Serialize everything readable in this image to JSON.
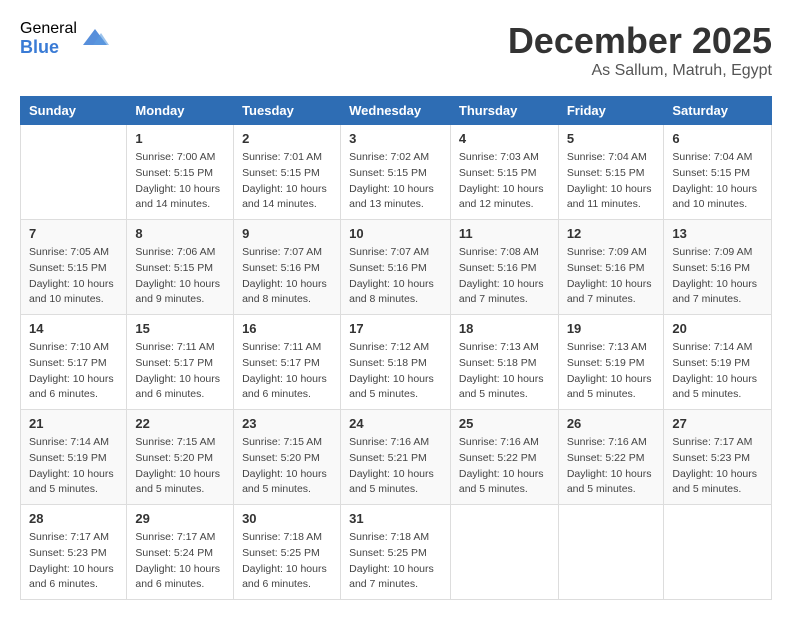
{
  "logo": {
    "general": "General",
    "blue": "Blue"
  },
  "title": {
    "month": "December 2025",
    "location": "As Sallum, Matruh, Egypt"
  },
  "headers": [
    "Sunday",
    "Monday",
    "Tuesday",
    "Wednesday",
    "Thursday",
    "Friday",
    "Saturday"
  ],
  "weeks": [
    [
      {
        "day": "",
        "sunrise": "",
        "sunset": "",
        "daylight": ""
      },
      {
        "day": "1",
        "sunrise": "Sunrise: 7:00 AM",
        "sunset": "Sunset: 5:15 PM",
        "daylight": "Daylight: 10 hours and 14 minutes."
      },
      {
        "day": "2",
        "sunrise": "Sunrise: 7:01 AM",
        "sunset": "Sunset: 5:15 PM",
        "daylight": "Daylight: 10 hours and 14 minutes."
      },
      {
        "day": "3",
        "sunrise": "Sunrise: 7:02 AM",
        "sunset": "Sunset: 5:15 PM",
        "daylight": "Daylight: 10 hours and 13 minutes."
      },
      {
        "day": "4",
        "sunrise": "Sunrise: 7:03 AM",
        "sunset": "Sunset: 5:15 PM",
        "daylight": "Daylight: 10 hours and 12 minutes."
      },
      {
        "day": "5",
        "sunrise": "Sunrise: 7:04 AM",
        "sunset": "Sunset: 5:15 PM",
        "daylight": "Daylight: 10 hours and 11 minutes."
      },
      {
        "day": "6",
        "sunrise": "Sunrise: 7:04 AM",
        "sunset": "Sunset: 5:15 PM",
        "daylight": "Daylight: 10 hours and 10 minutes."
      }
    ],
    [
      {
        "day": "7",
        "sunrise": "Sunrise: 7:05 AM",
        "sunset": "Sunset: 5:15 PM",
        "daylight": "Daylight: 10 hours and 10 minutes."
      },
      {
        "day": "8",
        "sunrise": "Sunrise: 7:06 AM",
        "sunset": "Sunset: 5:15 PM",
        "daylight": "Daylight: 10 hours and 9 minutes."
      },
      {
        "day": "9",
        "sunrise": "Sunrise: 7:07 AM",
        "sunset": "Sunset: 5:16 PM",
        "daylight": "Daylight: 10 hours and 8 minutes."
      },
      {
        "day": "10",
        "sunrise": "Sunrise: 7:07 AM",
        "sunset": "Sunset: 5:16 PM",
        "daylight": "Daylight: 10 hours and 8 minutes."
      },
      {
        "day": "11",
        "sunrise": "Sunrise: 7:08 AM",
        "sunset": "Sunset: 5:16 PM",
        "daylight": "Daylight: 10 hours and 7 minutes."
      },
      {
        "day": "12",
        "sunrise": "Sunrise: 7:09 AM",
        "sunset": "Sunset: 5:16 PM",
        "daylight": "Daylight: 10 hours and 7 minutes."
      },
      {
        "day": "13",
        "sunrise": "Sunrise: 7:09 AM",
        "sunset": "Sunset: 5:16 PM",
        "daylight": "Daylight: 10 hours and 7 minutes."
      }
    ],
    [
      {
        "day": "14",
        "sunrise": "Sunrise: 7:10 AM",
        "sunset": "Sunset: 5:17 PM",
        "daylight": "Daylight: 10 hours and 6 minutes."
      },
      {
        "day": "15",
        "sunrise": "Sunrise: 7:11 AM",
        "sunset": "Sunset: 5:17 PM",
        "daylight": "Daylight: 10 hours and 6 minutes."
      },
      {
        "day": "16",
        "sunrise": "Sunrise: 7:11 AM",
        "sunset": "Sunset: 5:17 PM",
        "daylight": "Daylight: 10 hours and 6 minutes."
      },
      {
        "day": "17",
        "sunrise": "Sunrise: 7:12 AM",
        "sunset": "Sunset: 5:18 PM",
        "daylight": "Daylight: 10 hours and 5 minutes."
      },
      {
        "day": "18",
        "sunrise": "Sunrise: 7:13 AM",
        "sunset": "Sunset: 5:18 PM",
        "daylight": "Daylight: 10 hours and 5 minutes."
      },
      {
        "day": "19",
        "sunrise": "Sunrise: 7:13 AM",
        "sunset": "Sunset: 5:19 PM",
        "daylight": "Daylight: 10 hours and 5 minutes."
      },
      {
        "day": "20",
        "sunrise": "Sunrise: 7:14 AM",
        "sunset": "Sunset: 5:19 PM",
        "daylight": "Daylight: 10 hours and 5 minutes."
      }
    ],
    [
      {
        "day": "21",
        "sunrise": "Sunrise: 7:14 AM",
        "sunset": "Sunset: 5:19 PM",
        "daylight": "Daylight: 10 hours and 5 minutes."
      },
      {
        "day": "22",
        "sunrise": "Sunrise: 7:15 AM",
        "sunset": "Sunset: 5:20 PM",
        "daylight": "Daylight: 10 hours and 5 minutes."
      },
      {
        "day": "23",
        "sunrise": "Sunrise: 7:15 AM",
        "sunset": "Sunset: 5:20 PM",
        "daylight": "Daylight: 10 hours and 5 minutes."
      },
      {
        "day": "24",
        "sunrise": "Sunrise: 7:16 AM",
        "sunset": "Sunset: 5:21 PM",
        "daylight": "Daylight: 10 hours and 5 minutes."
      },
      {
        "day": "25",
        "sunrise": "Sunrise: 7:16 AM",
        "sunset": "Sunset: 5:22 PM",
        "daylight": "Daylight: 10 hours and 5 minutes."
      },
      {
        "day": "26",
        "sunrise": "Sunrise: 7:16 AM",
        "sunset": "Sunset: 5:22 PM",
        "daylight": "Daylight: 10 hours and 5 minutes."
      },
      {
        "day": "27",
        "sunrise": "Sunrise: 7:17 AM",
        "sunset": "Sunset: 5:23 PM",
        "daylight": "Daylight: 10 hours and 5 minutes."
      }
    ],
    [
      {
        "day": "28",
        "sunrise": "Sunrise: 7:17 AM",
        "sunset": "Sunset: 5:23 PM",
        "daylight": "Daylight: 10 hours and 6 minutes."
      },
      {
        "day": "29",
        "sunrise": "Sunrise: 7:17 AM",
        "sunset": "Sunset: 5:24 PM",
        "daylight": "Daylight: 10 hours and 6 minutes."
      },
      {
        "day": "30",
        "sunrise": "Sunrise: 7:18 AM",
        "sunset": "Sunset: 5:25 PM",
        "daylight": "Daylight: 10 hours and 6 minutes."
      },
      {
        "day": "31",
        "sunrise": "Sunrise: 7:18 AM",
        "sunset": "Sunset: 5:25 PM",
        "daylight": "Daylight: 10 hours and 7 minutes."
      },
      {
        "day": "",
        "sunrise": "",
        "sunset": "",
        "daylight": ""
      },
      {
        "day": "",
        "sunrise": "",
        "sunset": "",
        "daylight": ""
      },
      {
        "day": "",
        "sunrise": "",
        "sunset": "",
        "daylight": ""
      }
    ]
  ]
}
